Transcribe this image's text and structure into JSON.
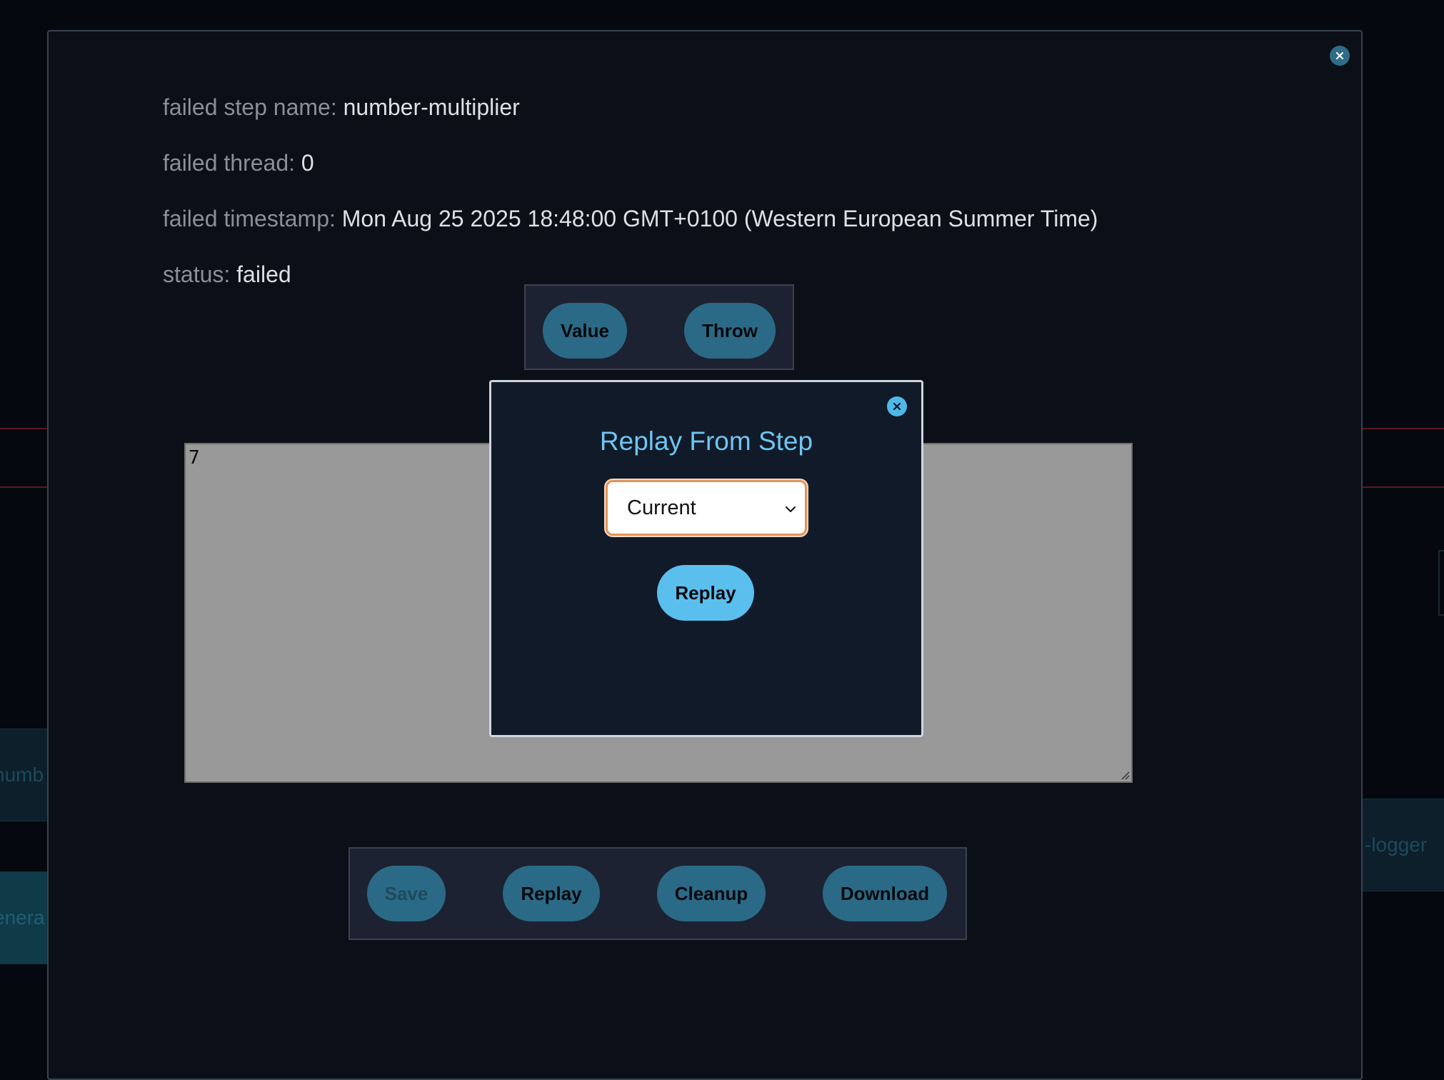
{
  "background": {
    "card_left_top": "numb",
    "card_left_bottom": "enera",
    "card_right": "-logger"
  },
  "modal": {
    "close_icon": "close-icon",
    "fields": [
      {
        "label": "failed step name:",
        "value": "number-multiplier"
      },
      {
        "label": "failed thread:",
        "value": "0"
      },
      {
        "label": "failed timestamp:",
        "value": "Mon Aug 25 2025 18:48:00 GMT+0100 (Western European Summer Time)"
      },
      {
        "label": "status:",
        "value": "failed"
      }
    ],
    "toggle": {
      "value_label": "Value",
      "throw_label": "Throw"
    },
    "editor": {
      "content": "7"
    },
    "actions": {
      "save_label": "Save",
      "replay_label": "Replay",
      "cleanup_label": "Cleanup",
      "download_label": "Download"
    }
  },
  "dialog": {
    "title": "Replay From Step",
    "select": {
      "selected": "Current"
    },
    "replay_label": "Replay",
    "close_icon": "close-icon"
  },
  "colors": {
    "accent": "#5bbfee",
    "button": "#2b6a86",
    "select_focus": "#e3945a",
    "background": "#0b0f17"
  }
}
